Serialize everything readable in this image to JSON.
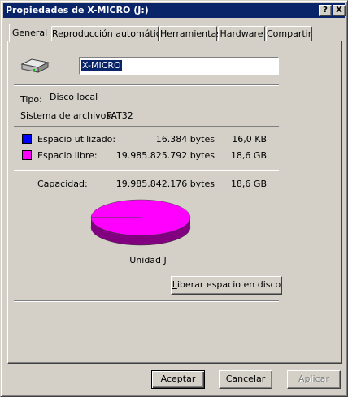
{
  "window": {
    "title": "Propiedades de X-MICRO (J:)",
    "help_glyph": "?",
    "close_glyph": "X"
  },
  "tabs": [
    {
      "label": "General",
      "active": true
    },
    {
      "label": "Reproducción automática",
      "active": false
    },
    {
      "label": "Herramientas",
      "active": false
    },
    {
      "label": "Hardware",
      "active": false
    },
    {
      "label": "Compartir",
      "active": false
    }
  ],
  "general": {
    "volume_name": "X-MICRO",
    "drive_icon": "drive-icon",
    "type_label": "Tipo:",
    "type_value": "Disco local",
    "fs_label": "Sistema de archivos:",
    "fs_value": "FAT32",
    "used_label": "Espacio utilizado:",
    "used_bytes": "16.384 bytes",
    "used_size": "16,0 KB",
    "free_label": "Espacio libre:",
    "free_bytes": "19.985.825.792 bytes",
    "free_size": "18,6 GB",
    "capacity_label": "Capacidad:",
    "capacity_bytes": "19.985.842.176 bytes",
    "capacity_size": "18,6 GB",
    "drive_label": "Unidad J",
    "cleanup_label_underlined": "L",
    "cleanup_label_rest": "iberar espacio en disco"
  },
  "colors": {
    "used": "#0000ff",
    "free": "#ff00ff",
    "free_dark": "#800080",
    "titlebar": "#0a246a"
  },
  "buttons": {
    "ok": "Aceptar",
    "cancel": "Cancelar",
    "apply": "Aplicar"
  }
}
